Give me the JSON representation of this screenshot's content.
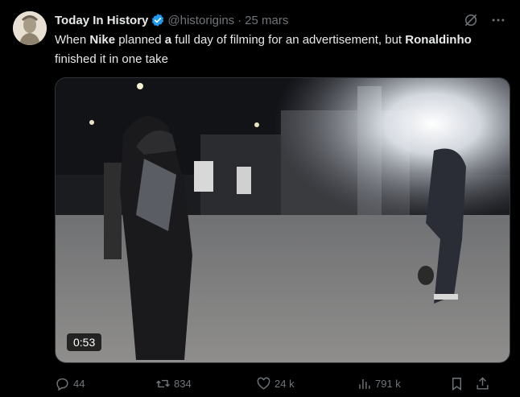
{
  "author": {
    "display_name": "Today In History",
    "handle": "@historigins",
    "separator": "·",
    "date": "25 mars"
  },
  "tweet": {
    "segments": [
      {
        "text": "When ",
        "bold": false
      },
      {
        "text": "Nike",
        "bold": true
      },
      {
        "text": " planned ",
        "bold": false
      },
      {
        "text": "a",
        "bold": true
      },
      {
        "text": " full day of filming for an advertisement, but ",
        "bold": false
      },
      {
        "text": "Ronaldinho",
        "bold": true
      },
      {
        "text": " finished it in one take",
        "bold": false
      }
    ]
  },
  "media": {
    "duration": "0:53"
  },
  "actions": {
    "replies": "44",
    "reposts": "834",
    "likes": "24 k",
    "views": "791 k"
  },
  "colors": {
    "background": "#000000",
    "text": "#e7e9ea",
    "muted": "#71767b",
    "verified": "#1d9bf0"
  },
  "icons": [
    "verified-badge-icon",
    "grok-icon",
    "more-icon",
    "reply-icon",
    "repost-icon",
    "like-icon",
    "views-icon",
    "bookmark-icon",
    "share-icon"
  ]
}
